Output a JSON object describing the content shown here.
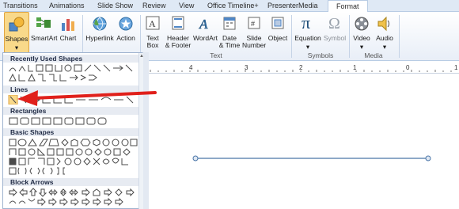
{
  "tabs": [
    "Transitions",
    "Animations",
    "Slide Show",
    "Review",
    "View",
    "Office Timeline+",
    "PresenterMedia",
    "Format"
  ],
  "ribbon": {
    "buttons": {
      "shapes": "Shapes",
      "smartart": "SmartArt",
      "chart": "Chart",
      "hyperlink": "Hyperlink",
      "action": "Action",
      "textbox": "Text\nBox",
      "header_footer": "Header\n& Footer",
      "wordart": "WordArt",
      "date_time": "Date\n& Time",
      "slide_number": "Slide\nNumber",
      "object": "Object",
      "equation": "Equation",
      "symbol": "Symbol",
      "video": "Video",
      "audio": "Audio"
    },
    "groups": {
      "text": "Text",
      "symbols": "Symbols",
      "media": "Media"
    }
  },
  "ruler": {
    "numbers": [
      "4",
      "3",
      "2",
      "1",
      "0",
      "1"
    ]
  },
  "panel": {
    "sections": {
      "recent": "Recently Used Shapes",
      "lines": "Lines",
      "rectangles": "Rectangles",
      "basic": "Basic Shapes",
      "block_arrows": "Block Arrows"
    }
  },
  "colors": {
    "arrow": "#e0201b",
    "shapes_button_bg": "#f9d98a",
    "tab_bar_bg": "#dfe9f5",
    "line_shape": "#4a76a8"
  }
}
